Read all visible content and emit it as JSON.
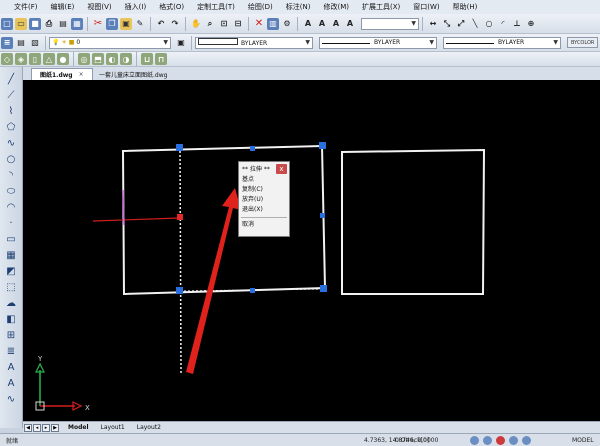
{
  "menu": [
    "文件(F)",
    "编辑(E)",
    "视图(V)",
    "插入(I)",
    "格式(O)",
    "定制工具(T)",
    "绘图(D)",
    "标注(N)",
    "修改(M)",
    "扩展工具(X)",
    "窗口(W)",
    "帮助(H)"
  ],
  "toolbar": {
    "layer_value": "0",
    "color_value": "BYLAYER",
    "linetype_value": "BYLAYER",
    "lineweight_value": "BYLAYER",
    "plotstyle_label": "BYCOLOR",
    "style_combo_value": ""
  },
  "doc_tabs": [
    {
      "label": "图纸1.dwg",
      "active": true,
      "close": "×"
    },
    {
      "label": "一套儿童床立面图纸.dwg",
      "active": false
    }
  ],
  "context_menu": {
    "title": "** 拉伸 **",
    "close": "x",
    "items": [
      "基点",
      "复制(C)",
      "放弃(U)",
      "退出(X)"
    ],
    "cancel": "取消"
  },
  "ucs": {
    "x_label": "X",
    "y_label": "Y"
  },
  "layout_tabs": [
    "Model",
    "Layout1",
    "Layout2"
  ],
  "status": {
    "left": "就绪",
    "coords": "4.7363, 14.8746, 0.0000",
    "otrack": "0 Otrack[0]",
    "model": "MODEL"
  },
  "colors": {
    "canvas": "#000000",
    "grip": "#2a6fe0",
    "arrow": "#e0221c",
    "ucs_x": "#d31d1d",
    "ucs_y": "#2bb24c"
  }
}
